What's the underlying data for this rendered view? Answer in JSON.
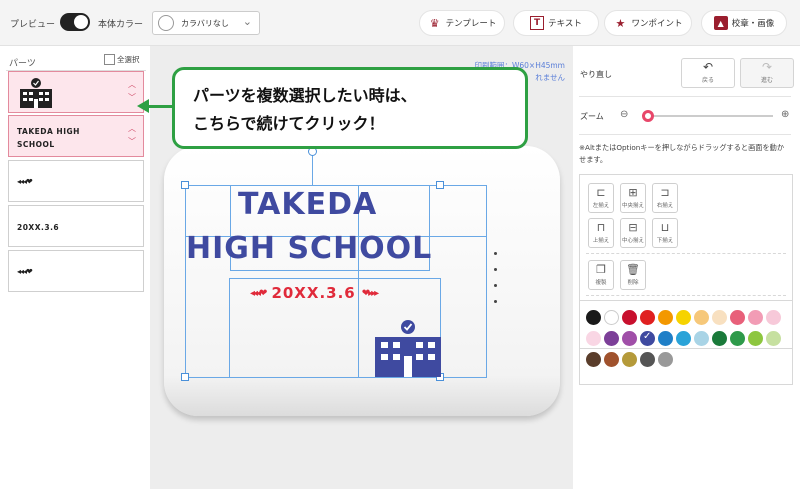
{
  "topbar": {
    "preview_label": "プレビュー",
    "body_color_label": "本体カラー",
    "body_color_value": "カラバリなし",
    "buttons": [
      {
        "label": "テンプレート",
        "icon": "crest-icon"
      },
      {
        "label": "テキスト",
        "icon": "text-icon"
      },
      {
        "label": "ワンポイント",
        "icon": "star-icon"
      },
      {
        "label": "校章・画像",
        "icon": "image-icon"
      }
    ]
  },
  "parts": {
    "title": "パーツ",
    "select_all": "全選択",
    "items": [
      {
        "kind": "school-image",
        "selected": true
      },
      {
        "kind": "text",
        "text_line1": "TAKEDA HIGH",
        "text_line2": "SCHOOL",
        "selected": true
      },
      {
        "kind": "hearts",
        "selected": false
      },
      {
        "kind": "text",
        "text_line1": "20XX.3.6",
        "selected": false
      },
      {
        "kind": "hearts",
        "selected": false
      }
    ]
  },
  "canvas": {
    "print_range": "印刷範囲：W60×H45mm",
    "warning_tail": "れません",
    "line1": "TAKEDA",
    "line2": "HIGH SCHOOL",
    "date": "20XX.3.6"
  },
  "callout": {
    "line1": "パーツを複数選択したい時は、",
    "line2": "こちらで続けてクリック！",
    "color": "#2ea043"
  },
  "right": {
    "history_label": "やり直し",
    "undo_label": "戻る",
    "redo_label": "進む",
    "zoom_label": "ズーム",
    "note": "※AltまたはOptionキーを押しながらドラッグすると画面を動かせます。",
    "align_tools": [
      "左揃え",
      "中央揃え",
      "右揃え",
      "上揃え",
      "中心揃え",
      "下揃え"
    ],
    "edit_tools": [
      "複製",
      "削除"
    ],
    "palette": [
      "#1a1a1a",
      "#ffffff",
      "#c8102e",
      "#e02020",
      "#f39800",
      "#f6d300",
      "#f6c87a",
      "#f8e0c0",
      "#e8607a",
      "#f29cb5",
      "#f7c9d9",
      "#f9d6e4",
      "#7c3f98",
      "#a04fa8",
      "#3f4aa0",
      "#1f7fc7",
      "#2aa3d8",
      "#a9d4e6",
      "#1a7a3a",
      "#2e9a4a",
      "#8dc63f",
      "#c6e0a0",
      "#5a3d2b",
      "#a0522d",
      "#b59a3a",
      "#555555",
      "#999999"
    ],
    "selected_color": "#3f4aa0"
  }
}
